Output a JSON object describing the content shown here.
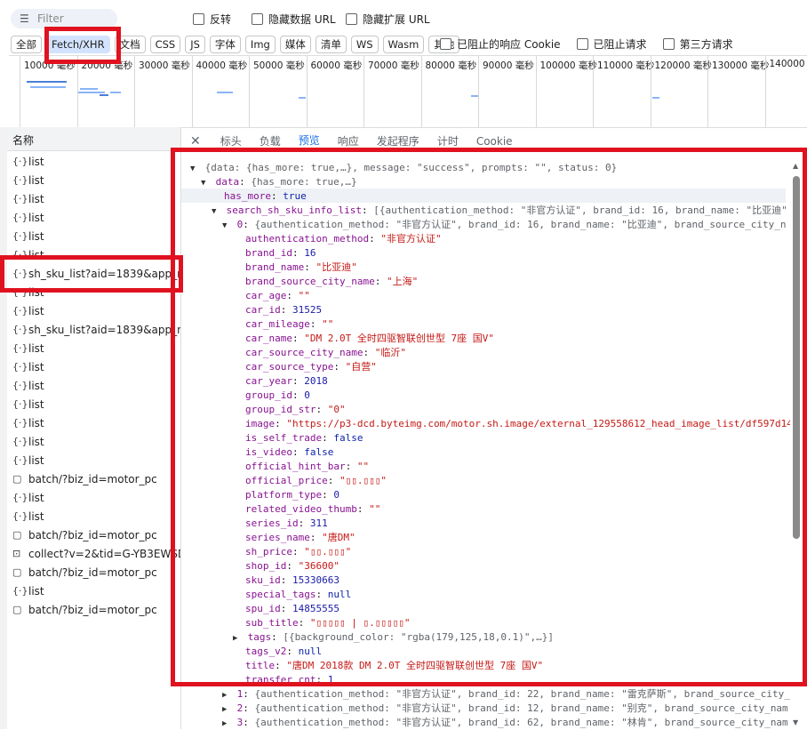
{
  "toolbar": {
    "filter_placeholder": "Filter",
    "invert": "反转",
    "hide_data_url": "隐藏数据 URL",
    "hide_ext_url": "隐藏扩展 URL"
  },
  "chips": [
    "全部",
    "Fetch/XHR",
    "文档",
    "CSS",
    "JS",
    "字体",
    "Img",
    "媒体",
    "清单",
    "WS",
    "Wasm",
    "其他"
  ],
  "row2_checks": {
    "blocked_cookies": "已阻止的响应 Cookie",
    "blocked_requests": "已阻止请求",
    "third_party": "第三方请求"
  },
  "timeline": {
    "ticks": [
      "10000 毫秒",
      "20000 毫秒",
      "30000 毫秒",
      "40000 毫秒",
      "50000 毫秒",
      "60000 毫秒",
      "70000 毫秒",
      "80000 毫秒",
      "90000 毫秒",
      "100000 毫秒",
      "110000 毫秒",
      "120000 毫秒",
      "130000 毫秒",
      "140000"
    ]
  },
  "requests": {
    "header": "名称",
    "items": [
      {
        "icon": "{·}",
        "name": "list"
      },
      {
        "icon": "{·}",
        "name": "list"
      },
      {
        "icon": "{·}",
        "name": "list"
      },
      {
        "icon": "{·}",
        "name": "list"
      },
      {
        "icon": "{·}",
        "name": "list"
      },
      {
        "icon": "{·}",
        "name": "list"
      },
      {
        "icon": "{·}",
        "name": "sh_sku_list?aid=1839&app_na..."
      },
      {
        "icon": "{·}",
        "name": "list"
      },
      {
        "icon": "{·}",
        "name": "list"
      },
      {
        "icon": "{·}",
        "name": "sh_sku_list?aid=1839&app_na..."
      },
      {
        "icon": "{·}",
        "name": "list"
      },
      {
        "icon": "{·}",
        "name": "list"
      },
      {
        "icon": "{·}",
        "name": "list"
      },
      {
        "icon": "{·}",
        "name": "list"
      },
      {
        "icon": "{·}",
        "name": "list"
      },
      {
        "icon": "{·}",
        "name": "list"
      },
      {
        "icon": "{·}",
        "name": "list"
      },
      {
        "icon": "▢",
        "name": "batch/?biz_id=motor_pc"
      },
      {
        "icon": "{·}",
        "name": "list"
      },
      {
        "icon": "{·}",
        "name": "list"
      },
      {
        "icon": "▢",
        "name": "batch/?biz_id=motor_pc"
      },
      {
        "icon": "⊡",
        "name": "collect?v=2&tid=G-YB3EWSD..."
      },
      {
        "icon": "▢",
        "name": "batch/?biz_id=motor_pc"
      },
      {
        "icon": "{·}",
        "name": "list"
      },
      {
        "icon": "▢",
        "name": "batch/?biz_id=motor_pc"
      }
    ]
  },
  "tabs": [
    "标头",
    "负载",
    "预览",
    "响应",
    "发起程序",
    "计时",
    "Cookie"
  ],
  "active_tab": "预览",
  "preview": {
    "root": "{data: {has_more: true,…}, message: \"success\", prompts: \"\", status: 0}",
    "data_line": "{has_more: true,…}",
    "has_more": "true",
    "list_summary": "[{authentication_method: \"非官方认证\", brand_id: 16, brand_name: \"比亚迪\"",
    "item0_summary": "{authentication_method: \"非官方认证\", brand_id: 16, brand_name: \"比亚迪\", brand_source_city_n",
    "fields": [
      {
        "k": "authentication_method",
        "v": "\"非官方认证\"",
        "t": "s"
      },
      {
        "k": "brand_id",
        "v": "16",
        "t": "n"
      },
      {
        "k": "brand_name",
        "v": "\"比亚迪\"",
        "t": "s"
      },
      {
        "k": "brand_source_city_name",
        "v": "\"上海\"",
        "t": "s"
      },
      {
        "k": "car_age",
        "v": "\"\"",
        "t": "s"
      },
      {
        "k": "car_id",
        "v": "31525",
        "t": "n"
      },
      {
        "k": "car_mileage",
        "v": "\"\"",
        "t": "s"
      },
      {
        "k": "car_name",
        "v": "\"DM 2.0T 全时四驱智联创世型 7座 国V\"",
        "t": "s"
      },
      {
        "k": "car_source_city_name",
        "v": "\"临沂\"",
        "t": "s"
      },
      {
        "k": "car_source_type",
        "v": "\"自营\"",
        "t": "s"
      },
      {
        "k": "car_year",
        "v": "2018",
        "t": "n"
      },
      {
        "k": "group_id",
        "v": "0",
        "t": "n"
      },
      {
        "k": "group_id_str",
        "v": "\"0\"",
        "t": "s"
      },
      {
        "k": "image",
        "v": "\"https://p3-dcd.byteimg.com/motor.sh.image/external_129558612_head_image_list/df597d14",
        "t": "s"
      },
      {
        "k": "is_self_trade",
        "v": "false",
        "t": "kw"
      },
      {
        "k": "is_video",
        "v": "false",
        "t": "kw"
      },
      {
        "k": "official_hint_bar",
        "v": "\"\"",
        "t": "s"
      },
      {
        "k": "official_price",
        "v": "\"▯▯.▯▯▯\"",
        "t": "s"
      },
      {
        "k": "platform_type",
        "v": "0",
        "t": "n"
      },
      {
        "k": "related_video_thumb",
        "v": "\"\"",
        "t": "s"
      },
      {
        "k": "series_id",
        "v": "311",
        "t": "n"
      },
      {
        "k": "series_name",
        "v": "\"唐DM\"",
        "t": "s"
      },
      {
        "k": "sh_price",
        "v": "\"▯▯.▯▯▯\"",
        "t": "s"
      },
      {
        "k": "shop_id",
        "v": "\"36600\"",
        "t": "s"
      },
      {
        "k": "sku_id",
        "v": "15330663",
        "t": "n"
      },
      {
        "k": "special_tags",
        "v": "null",
        "t": "kw"
      },
      {
        "k": "spu_id",
        "v": "14855555",
        "t": "n"
      },
      {
        "k": "sub_title",
        "v": "\"▯▯▯▯▯ | ▯.▯▯▯▯▯\"",
        "t": "s"
      },
      {
        "k": "tags",
        "v": "[{background_color: \"rgba(179,125,18,0.1)\",…}]",
        "t": "g",
        "expandable": true
      },
      {
        "k": "tags_v2",
        "v": "null",
        "t": "kw"
      },
      {
        "k": "title",
        "v": "\"唐DM 2018款 DM 2.0T 全时四驱智联创世型 7座 国V\"",
        "t": "s"
      },
      {
        "k": "transfer_cnt",
        "v": "1",
        "t": "n"
      }
    ],
    "siblings": [
      {
        "idx": "1",
        "summary": "{authentication_method: \"非官方认证\", brand_id: 22, brand_name: \"雷克萨斯\", brand_source_city_"
      },
      {
        "idx": "2",
        "summary": "{authentication_method: \"非官方认证\", brand_id: 12, brand_name: \"别克\", brand_source_city_nam"
      },
      {
        "idx": "3",
        "summary": "{authentication_method: \"非官方认证\", brand_id: 62, brand_name: \"林肯\", brand_source_city_nam"
      }
    ]
  },
  "colors": {
    "annotation_red": "#e0121f",
    "active_tab": "#1a73e8",
    "key": "#881391",
    "string": "#c41a16",
    "number": "#1a1aa6"
  }
}
